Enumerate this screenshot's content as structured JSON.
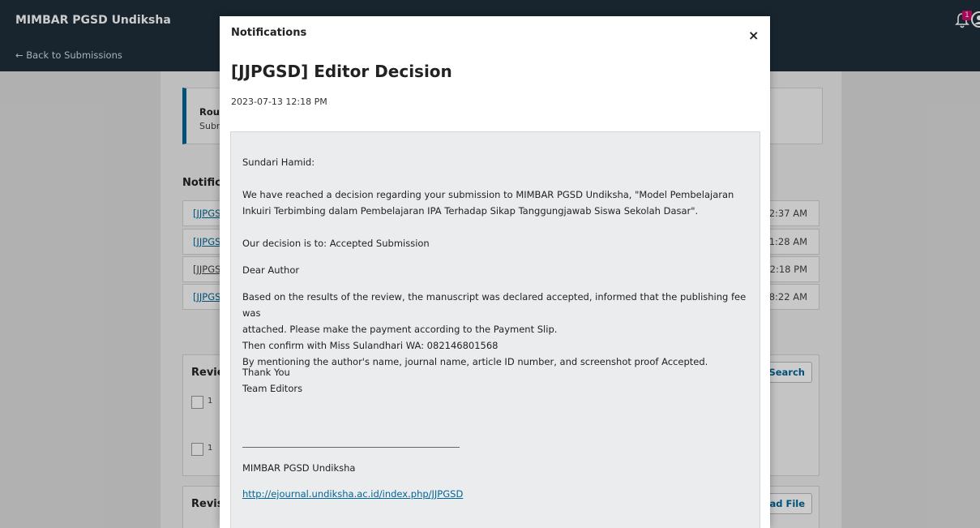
{
  "header": {
    "brand": "MIMBAR PGSD Undiksha",
    "back_link": "← Back to Submissions",
    "notification_count": "1"
  },
  "background": {
    "round_title": "Rou",
    "round_sub": "Subr",
    "notifications_label": "Notific",
    "rows": [
      {
        "link": "[JJPGS",
        "time": "2:37 AM"
      },
      {
        "link": "[JJPGS",
        "time": ")1:28 AM"
      },
      {
        "link": "[JJPGS",
        "time": "2:18 PM"
      },
      {
        "link": "[JJPGS",
        "time": "8:22 AM"
      }
    ],
    "review_title": "Revie",
    "search_button": "Search",
    "file_nums": [
      "1",
      "1"
    ],
    "revision_title": "Revis",
    "upload_button": "oad File"
  },
  "modal": {
    "title": "Notifications",
    "close": "×",
    "subject": "[JJPGSD] Editor Decision",
    "date": "2023-07-13 12:18 PM",
    "greeting": "Sundari Hamid:",
    "para1_line1": "We have reached a decision regarding your submission to MIMBAR PGSD Undiksha, \"Model Pembelajaran",
    "para1_line2": "Inkuiri Terbimbing dalam Pembelajaran IPA Terhadap Sikap Tanggungjawab Siswa Sekolah Dasar\".",
    "decision": "Our decision is to: Accepted Submission",
    "dear": "Dear Author",
    "body_line1": "Based on the results of the review, the manuscript was declared accepted, informed that the publishing fee was",
    "body_line2": "attached. Please make the payment according to the Payment Slip.",
    "body_line3": "Then confirm with Miss Sulandhari WA: 082146801568",
    "body_line4": "By mentioning the author's name, journal name, article ID number, and screenshot proof Accepted.",
    "thanks": "Thank You",
    "team": "Team Editors",
    "signature_name": "MIMBAR PGSD Undiksha",
    "signature_url": "http://ejournal.undiksha.ac.id/index.php/JJPGSD"
  }
}
